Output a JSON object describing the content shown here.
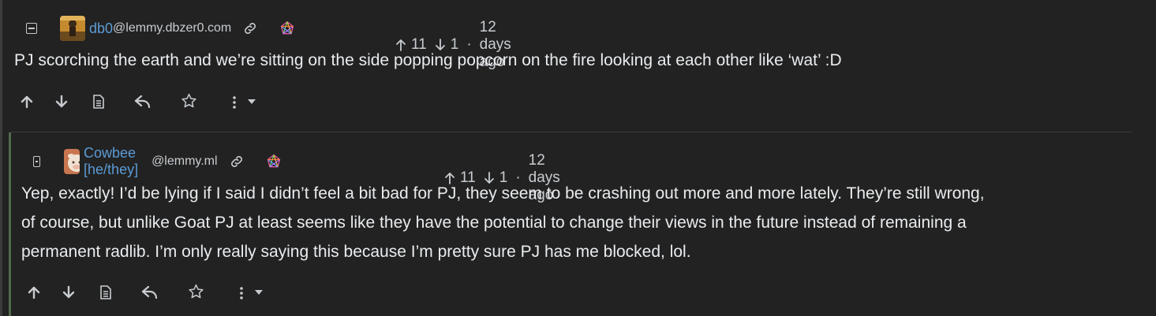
{
  "comments": [
    {
      "username": "db0",
      "instance": "@lemmy.dbzer0.com",
      "upvotes": "11",
      "downvotes": "1",
      "separator": "·",
      "time": "12 days ago",
      "body": "PJ scorching the earth and we’re sitting on the side popping popcorn on the fire looking at each other like ‘wat’ :D",
      "avatar_colors": [
        "#d9a441",
        "#6b4a1e"
      ]
    },
    {
      "username": "Cowbee [he/they]",
      "instance": "@lemmy.ml",
      "upvotes": "11",
      "downvotes": "1",
      "separator": "·",
      "time": "12 days ago",
      "body_lines": [
        "Yep, exactly! I’d be lying if I said I didn’t feel a bit bad for PJ, they seem to be crashing out more and more lately. They’re still wrong,",
        "of course, but unlike Goat PJ at least seems like they have the potential to change their views in the future instead of remaining a",
        "permanent radlib. I’m only really saying this because I’m pretty sure PJ has me blocked, lol."
      ],
      "avatar_colors": [
        "#c8764f",
        "#f1e3d3"
      ]
    }
  ],
  "icons": {
    "collapse": "collapse-icon",
    "link": "link-icon",
    "federation": "fediverse-icon",
    "upvote": "arrow-up-icon",
    "downvote": "arrow-down-icon",
    "source": "document-icon",
    "reply": "reply-icon",
    "save": "star-icon",
    "more": "more-vertical-icon",
    "dropdown": "caret-down-icon"
  },
  "colors": {
    "background": "#222222",
    "username": "#5b9bd5",
    "text": "#e9ecef",
    "muted": "#c8ccd0"
  }
}
